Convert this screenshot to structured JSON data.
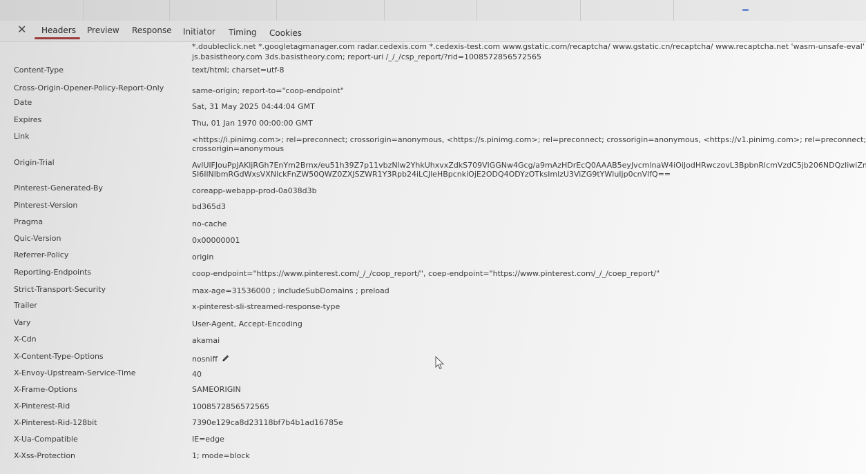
{
  "tabs": {
    "close_label": "✕",
    "items": [
      {
        "label": "Headers"
      },
      {
        "label": "Preview"
      },
      {
        "label": "Response"
      },
      {
        "label": "Initiator"
      },
      {
        "label": "Timing"
      },
      {
        "label": "Cookies"
      }
    ],
    "active_tab": "Headers",
    "active_color": "#9a3b3b"
  },
  "headers": {
    "csp_continuation": [
      "*.doubleclick.net *.googletagmanager.com radar.cedexis.com *.cedexis-test.com www.gstatic.com/recaptcha/ www.gstatic.cn/recaptcha/ www.recaptcha.net 'wasm-unsafe-eval'",
      "js.basistheory.com 3ds.basistheory.com; report-uri /_/_/csp_report/?rid=1008572856572565"
    ],
    "rows": [
      {
        "name": "Content-Type",
        "value": [
          "text/html; charset=utf-8"
        ]
      },
      {
        "name": "Cross-Origin-Opener-Policy-Report-Only",
        "value": [
          "same-origin; report-to=\"coop-endpoint\""
        ]
      },
      {
        "name": "Date",
        "value": [
          "Sat, 31 May 2025 04:44:04 GMT"
        ]
      },
      {
        "name": "Expires",
        "value": [
          "Thu, 01 Jan 1970 00:00:00 GMT"
        ]
      },
      {
        "name": "Link",
        "value": [
          "<https://i.pinimg.com>; rel=preconnect; crossorigin=anonymous, <https://s.pinimg.com>; rel=preconnect; crossorigin=anonymous, <https://v1.pinimg.com>; rel=preconnect;",
          "crossorigin=anonymous"
        ]
      },
      {
        "name": "Origin-Trial",
        "value": [
          "AvlUlFJouPpJAKljRGh7EnYm2Brnx/eu51h39Z7p11vbzNlw2YhkUhxvxZdkS709VlGGNw4Gcg/a9mAzHDrEcQ0AAAB5eyJvcmlnaW4iOiJodHRwczovL3BpbnRlcmVzdC5jb206NDQzIiwiZmVhdHVyZSI6",
          "SI6IlNlbmRGdWxsVXNlckFnZW50QWZ0ZXJSZWR1Y3Rpb24iLCJleHBpcnkiOjE2ODQ4ODYzOTksImlzU3ViZG9tYWluIjp0cnVlfQ=="
        ]
      },
      {
        "name": "Pinterest-Generated-By",
        "value": [
          "coreapp-webapp-prod-0a038d3b"
        ]
      },
      {
        "name": "Pinterest-Version",
        "value": [
          "bd365d3"
        ]
      },
      {
        "name": "Pragma",
        "value": [
          "no-cache"
        ]
      },
      {
        "name": "Quic-Version",
        "value": [
          "0x00000001"
        ]
      },
      {
        "name": "Referrer-Policy",
        "value": [
          "origin"
        ]
      },
      {
        "name": "Reporting-Endpoints",
        "value": [
          "coop-endpoint=\"https://www.pinterest.com/_/_/coop_report/\", coep-endpoint=\"https://www.pinterest.com/_/_/coep_report/\""
        ]
      },
      {
        "name": "Strict-Transport-Security",
        "value": [
          "max-age=31536000 ; includeSubDomains ; preload"
        ]
      },
      {
        "name": "Trailer",
        "value": [
          "x-pinterest-sli-streamed-response-type"
        ]
      },
      {
        "name": "Vary",
        "value": [
          "User-Agent, Accept-Encoding"
        ]
      },
      {
        "name": "X-Cdn",
        "value": [
          "akamai"
        ]
      },
      {
        "name": "X-Content-Type-Options",
        "value": [
          "nosniff"
        ],
        "icon": "pencil-icon"
      },
      {
        "name": "X-Envoy-Upstream-Service-Time",
        "value": [
          "40"
        ]
      },
      {
        "name": "X-Frame-Options",
        "value": [
          "SAMEORIGIN"
        ]
      },
      {
        "name": "X-Pinterest-Rid",
        "value": [
          "1008572856572565"
        ]
      },
      {
        "name": "X-Pinterest-Rid-128bit",
        "value": [
          "7390e129ca8d23118bf7b4b1ad16785e"
        ]
      },
      {
        "name": "X-Ua-Compatible",
        "value": [
          "IE=edge"
        ]
      },
      {
        "name": "X-Xss-Protection",
        "value": [
          "1; mode=block"
        ]
      }
    ]
  },
  "icons": {
    "close": "close-icon",
    "edit": "pencil-icon",
    "cursor": "mouse-pointer-icon"
  }
}
